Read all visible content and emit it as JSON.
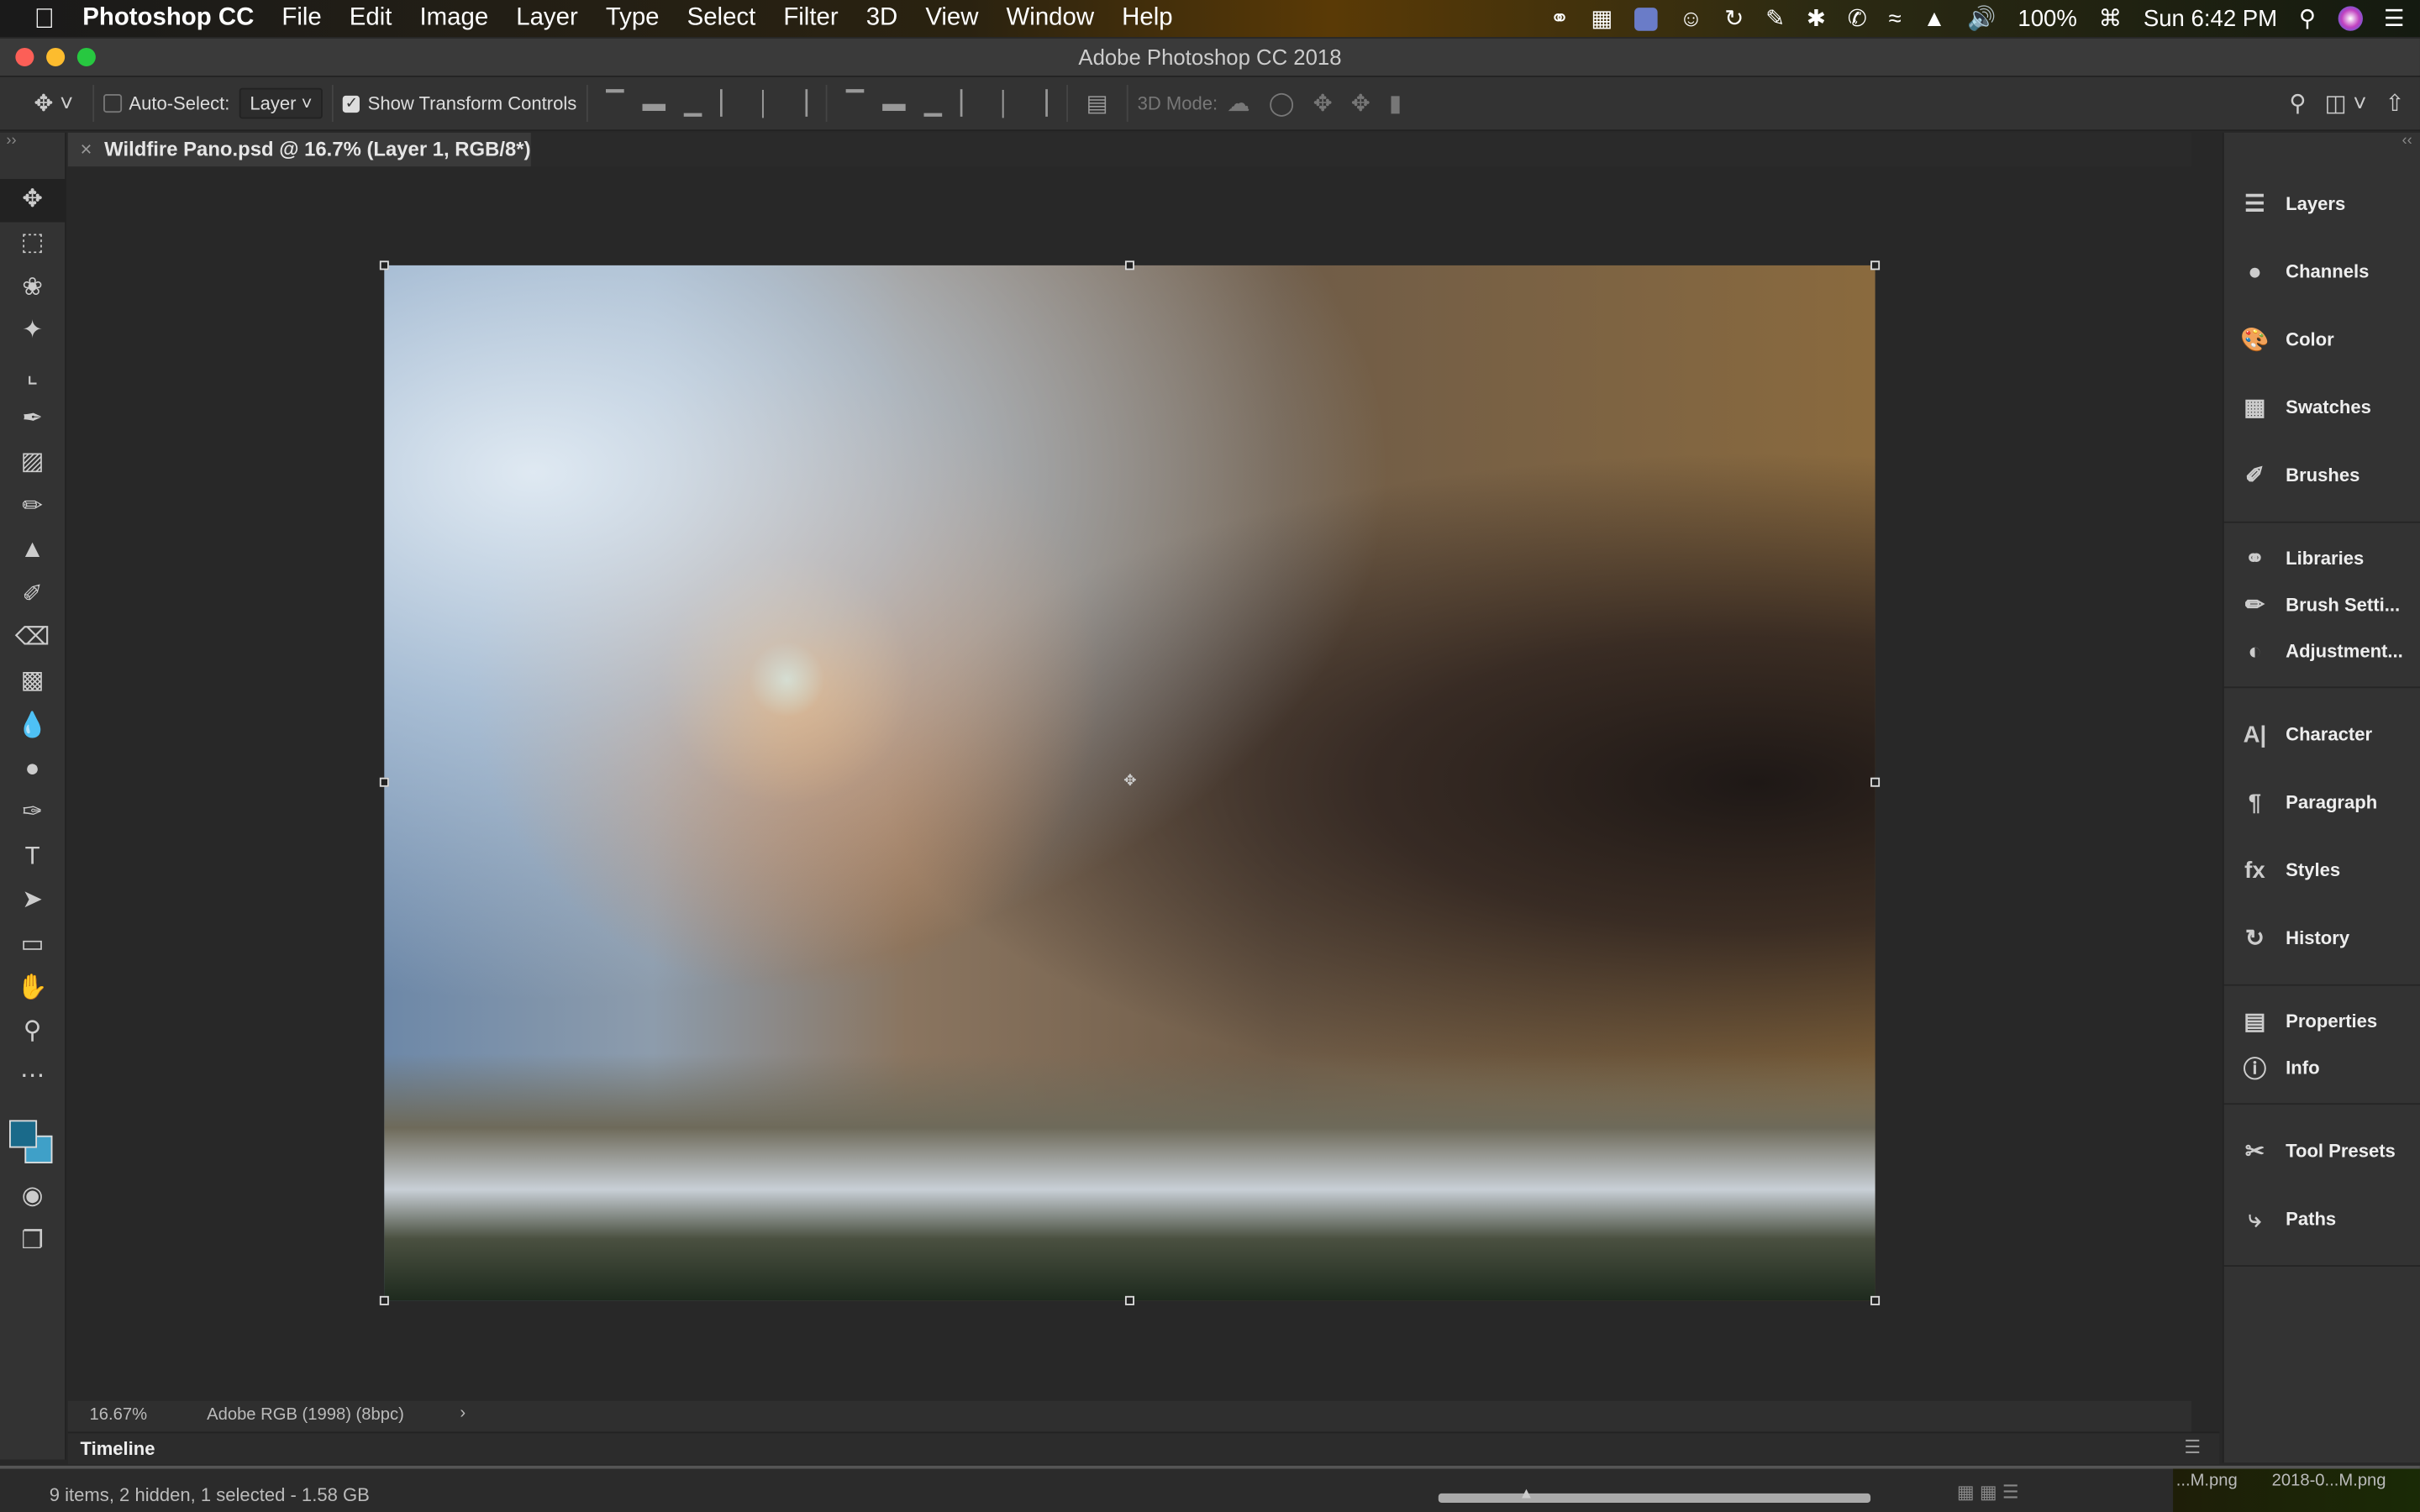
{
  "menubar": {
    "app": "Photoshop CC",
    "items": [
      "File",
      "Edit",
      "Image",
      "Layer",
      "Type",
      "Select",
      "Filter",
      "3D",
      "View",
      "Window",
      "Help"
    ],
    "battery": "100%",
    "clock": "Sun 6:42 PM"
  },
  "window": {
    "title": "Adobe Photoshop CC 2018"
  },
  "options": {
    "auto_select_label": "Auto-Select:",
    "auto_select_checked": false,
    "auto_select_target": "Layer",
    "show_transform_label": "Show Transform Controls",
    "show_transform_checked": true,
    "mode3d_label": "3D Mode:"
  },
  "document": {
    "tab_title": "Wildfire Pano.psd @ 16.7% (Layer 1, RGB/8*)",
    "zoom": "16.67%",
    "profile": "Adobe RGB (1998) (8bpc)"
  },
  "tools": [
    "move",
    "rectangular-marquee",
    "lasso",
    "magic-wand",
    "crop",
    "eyedropper",
    "healing-brush",
    "brush",
    "clone-stamp",
    "history-brush",
    "eraser",
    "gradient",
    "blur",
    "dodge",
    "pen",
    "type",
    "path-selection",
    "rectangle",
    "hand",
    "zoom",
    "more"
  ],
  "colors": {
    "foreground": "#1a6a8a",
    "background": "#3fa0c8"
  },
  "panels": [
    [
      "Layers",
      "Channels",
      "Color",
      "Swatches",
      "Brushes"
    ],
    [
      "Libraries",
      "Brush Setti...",
      "Adjustment..."
    ],
    [
      "Character",
      "Paragraph",
      "Styles",
      "History"
    ],
    [
      "Properties",
      "Info"
    ],
    [
      "Tool Presets",
      "Paths"
    ]
  ],
  "timeline": {
    "label": "Timeline"
  },
  "finder": {
    "status": "9 items, 2 hidden, 1 selected - 1.58 GB",
    "files": [
      "...M.png",
      "2018-0...M.png"
    ]
  }
}
